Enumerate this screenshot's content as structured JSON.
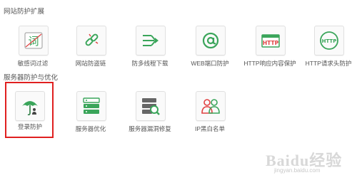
{
  "sections": [
    {
      "title": "网站防护扩展",
      "items": [
        {
          "label": "敏感词过滤",
          "icon": "word-filter-icon"
        },
        {
          "label": "网站防盗链",
          "icon": "broken-link-icon"
        },
        {
          "label": "防多线程下载",
          "icon": "multithread-download-icon"
        },
        {
          "label": "WEB端口防护",
          "icon": "at-sign-icon"
        },
        {
          "label": "HTTP响应内容保护",
          "icon": "http-response-icon",
          "icon_text": "HTTP"
        },
        {
          "label": "HTTP请求头防护",
          "icon": "http-request-icon",
          "icon_text": "HTTP"
        }
      ]
    },
    {
      "title": "服务器防护与优化",
      "items": [
        {
          "label": "登录防护",
          "icon": "login-protect-umbrella-icon"
        },
        {
          "label": "服务器优化",
          "icon": "server-optimize-icon"
        },
        {
          "label": "服务器漏洞修复",
          "icon": "server-vuln-repair-icon"
        },
        {
          "label": "IP黑白名单",
          "icon": "ip-blacklist-users-icon"
        }
      ]
    }
  ],
  "highlighted_item": "登录防护",
  "watermark": {
    "main": "Baidu经验",
    "sub": "jingyan.baidu.com"
  },
  "colors": {
    "accent_green": "#3aa55a",
    "highlight_red": "#e02020",
    "tile_border": "#e0e0e0"
  }
}
